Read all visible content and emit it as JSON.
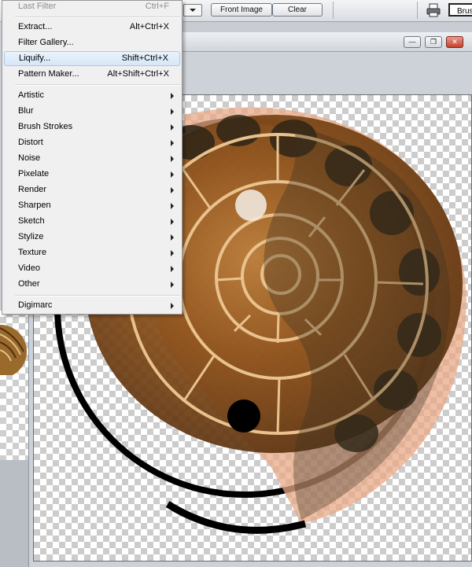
{
  "options_bar": {
    "front_image_label": "Front Image",
    "clear_label": "Clear",
    "brush_preset_label": "Brush"
  },
  "filter_menu": {
    "last_filter": {
      "label": "Last Filter",
      "shortcut": "Ctrl+F"
    },
    "items": [
      {
        "label": "Extract...",
        "shortcut": "Alt+Ctrl+X"
      },
      {
        "label": "Filter Gallery...",
        "shortcut": ""
      },
      {
        "label": "Liquify...",
        "shortcut": "Shift+Ctrl+X"
      },
      {
        "label": "Pattern Maker...",
        "shortcut": "Alt+Shift+Ctrl+X"
      }
    ],
    "submenus": [
      "Artistic",
      "Blur",
      "Brush Strokes",
      "Distort",
      "Noise",
      "Pixelate",
      "Render",
      "Sharpen",
      "Sketch",
      "Stylize",
      "Texture",
      "Video",
      "Other"
    ],
    "extra": [
      "Digimarc"
    ]
  },
  "document_window": {
    "minimize_glyph": "—",
    "restore_glyph": "❐",
    "close_glyph": "✕"
  },
  "colors": {
    "menu_highlight": "#d6e7f7",
    "menu_bg": "#f0f0f0",
    "shell_brown": "#8a4e16",
    "shell_overlay": "#e9a987",
    "stroke": "#000000"
  },
  "icons": {
    "printer": "printer-icon",
    "submenu": "submenu-arrow-icon",
    "minimize": "minimize-icon",
    "restore": "restore-icon",
    "close": "close-icon"
  }
}
